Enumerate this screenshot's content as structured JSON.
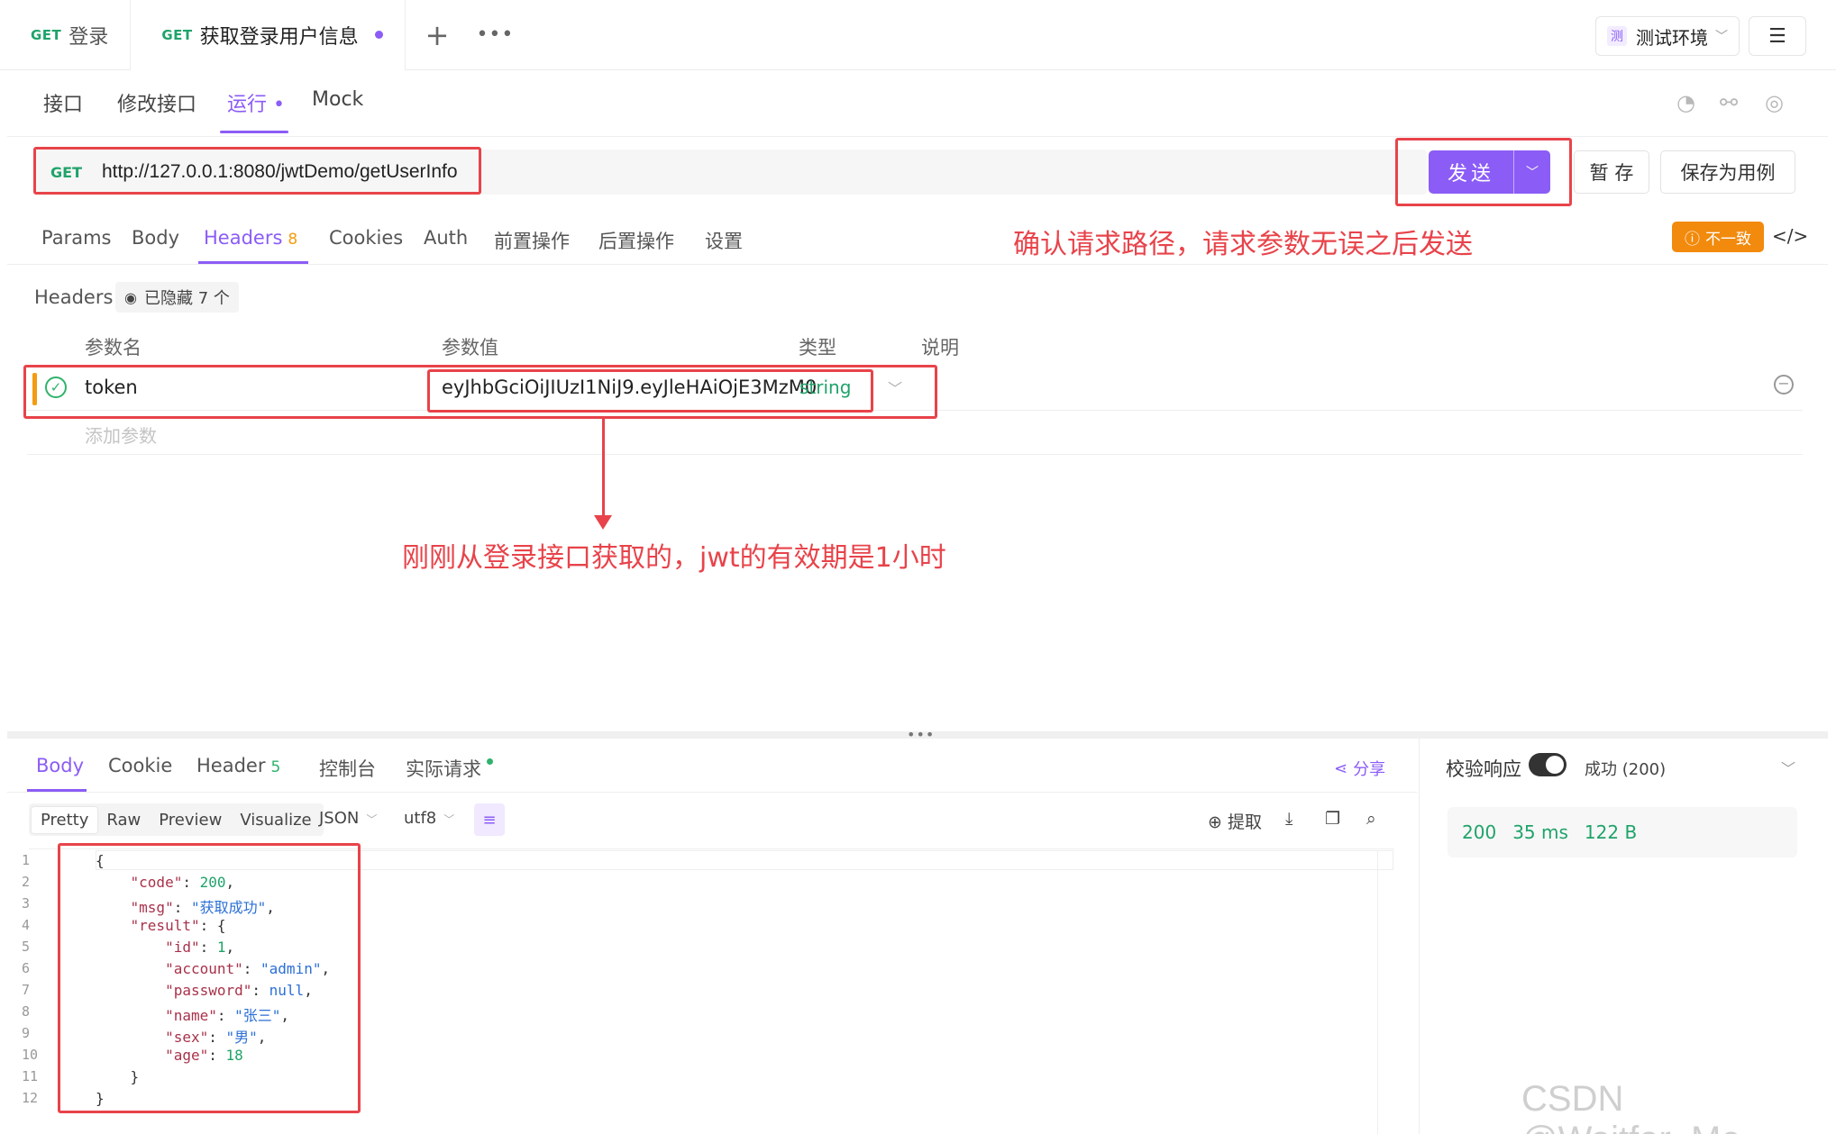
{
  "tabs": [
    {
      "method": "GET",
      "label": "登录",
      "active": false
    },
    {
      "method": "GET",
      "label": "获取登录用户信息",
      "active": true
    }
  ],
  "env": {
    "badge": "测",
    "label": "测试环境"
  },
  "subtabs": [
    "接口",
    "修改接口",
    "运行",
    "Mock"
  ],
  "request": {
    "method": "GET",
    "url": "http://127.0.0.1:8080/jwtDemo/getUserInfo",
    "send_label": "发送",
    "save_draft_label": "暂 存",
    "save_case_label": "保存为用例"
  },
  "req_tabs": [
    {
      "label": "Params"
    },
    {
      "label": "Body"
    },
    {
      "label": "Headers",
      "count": "8"
    },
    {
      "label": "Cookies"
    },
    {
      "label": "Auth"
    },
    {
      "label": "前置操作"
    },
    {
      "label": "后置操作"
    },
    {
      "label": "设置"
    }
  ],
  "mismatch_label": "不一致",
  "code_icon": "</>",
  "headers": {
    "label": "Headers",
    "hidden_label": "已隐藏 7 个",
    "columns": [
      "参数名",
      "参数值",
      "类型",
      "说明"
    ],
    "rows": [
      {
        "name": "token",
        "value": "eyJhbGciOiJIUzI1NiJ9.eyJleHAiOjE3MzM0",
        "type": "string"
      }
    ],
    "add_placeholder": "添加参数"
  },
  "annotations": {
    "send": "确认请求路径，请求参数无误之后发送",
    "token": "刚刚从登录接口获取的，jwt的有效期是1小时"
  },
  "response": {
    "tabs": [
      {
        "label": "Body"
      },
      {
        "label": "Cookie"
      },
      {
        "label": "Header",
        "count": "5"
      },
      {
        "label": "控制台"
      },
      {
        "label": "实际请求"
      }
    ],
    "share_label": "分享",
    "formats": [
      "Pretty",
      "Raw",
      "Preview",
      "Visualize"
    ],
    "lang": "JSON",
    "encoding": "utf8",
    "extract_label": "提取",
    "code_lines": [
      [
        "1",
        "{"
      ],
      [
        "2",
        "    \"code\": 200,"
      ],
      [
        "3",
        "    \"msg\": \"获取成功\","
      ],
      [
        "4",
        "    \"result\": {"
      ],
      [
        "5",
        "        \"id\": 1,"
      ],
      [
        "6",
        "        \"account\": \"admin\","
      ],
      [
        "7",
        "        \"password\": null,"
      ],
      [
        "8",
        "        \"name\": \"张三\","
      ],
      [
        "9",
        "        \"sex\": \"男\","
      ],
      [
        "10",
        "        \"age\": 18"
      ],
      [
        "11",
        "    }"
      ],
      [
        "12",
        "}"
      ]
    ]
  },
  "verify": {
    "label": "校验响应",
    "status": "成功 (200)",
    "code": "200",
    "time": "35 ms",
    "size": "122 B"
  },
  "watermark": "CSDN @Waitfor_Me",
  "colors": {
    "accent": "#8b5cf6",
    "method": "#1fa36a",
    "annotation": "#e8434a",
    "warning": "#f28a0d"
  }
}
